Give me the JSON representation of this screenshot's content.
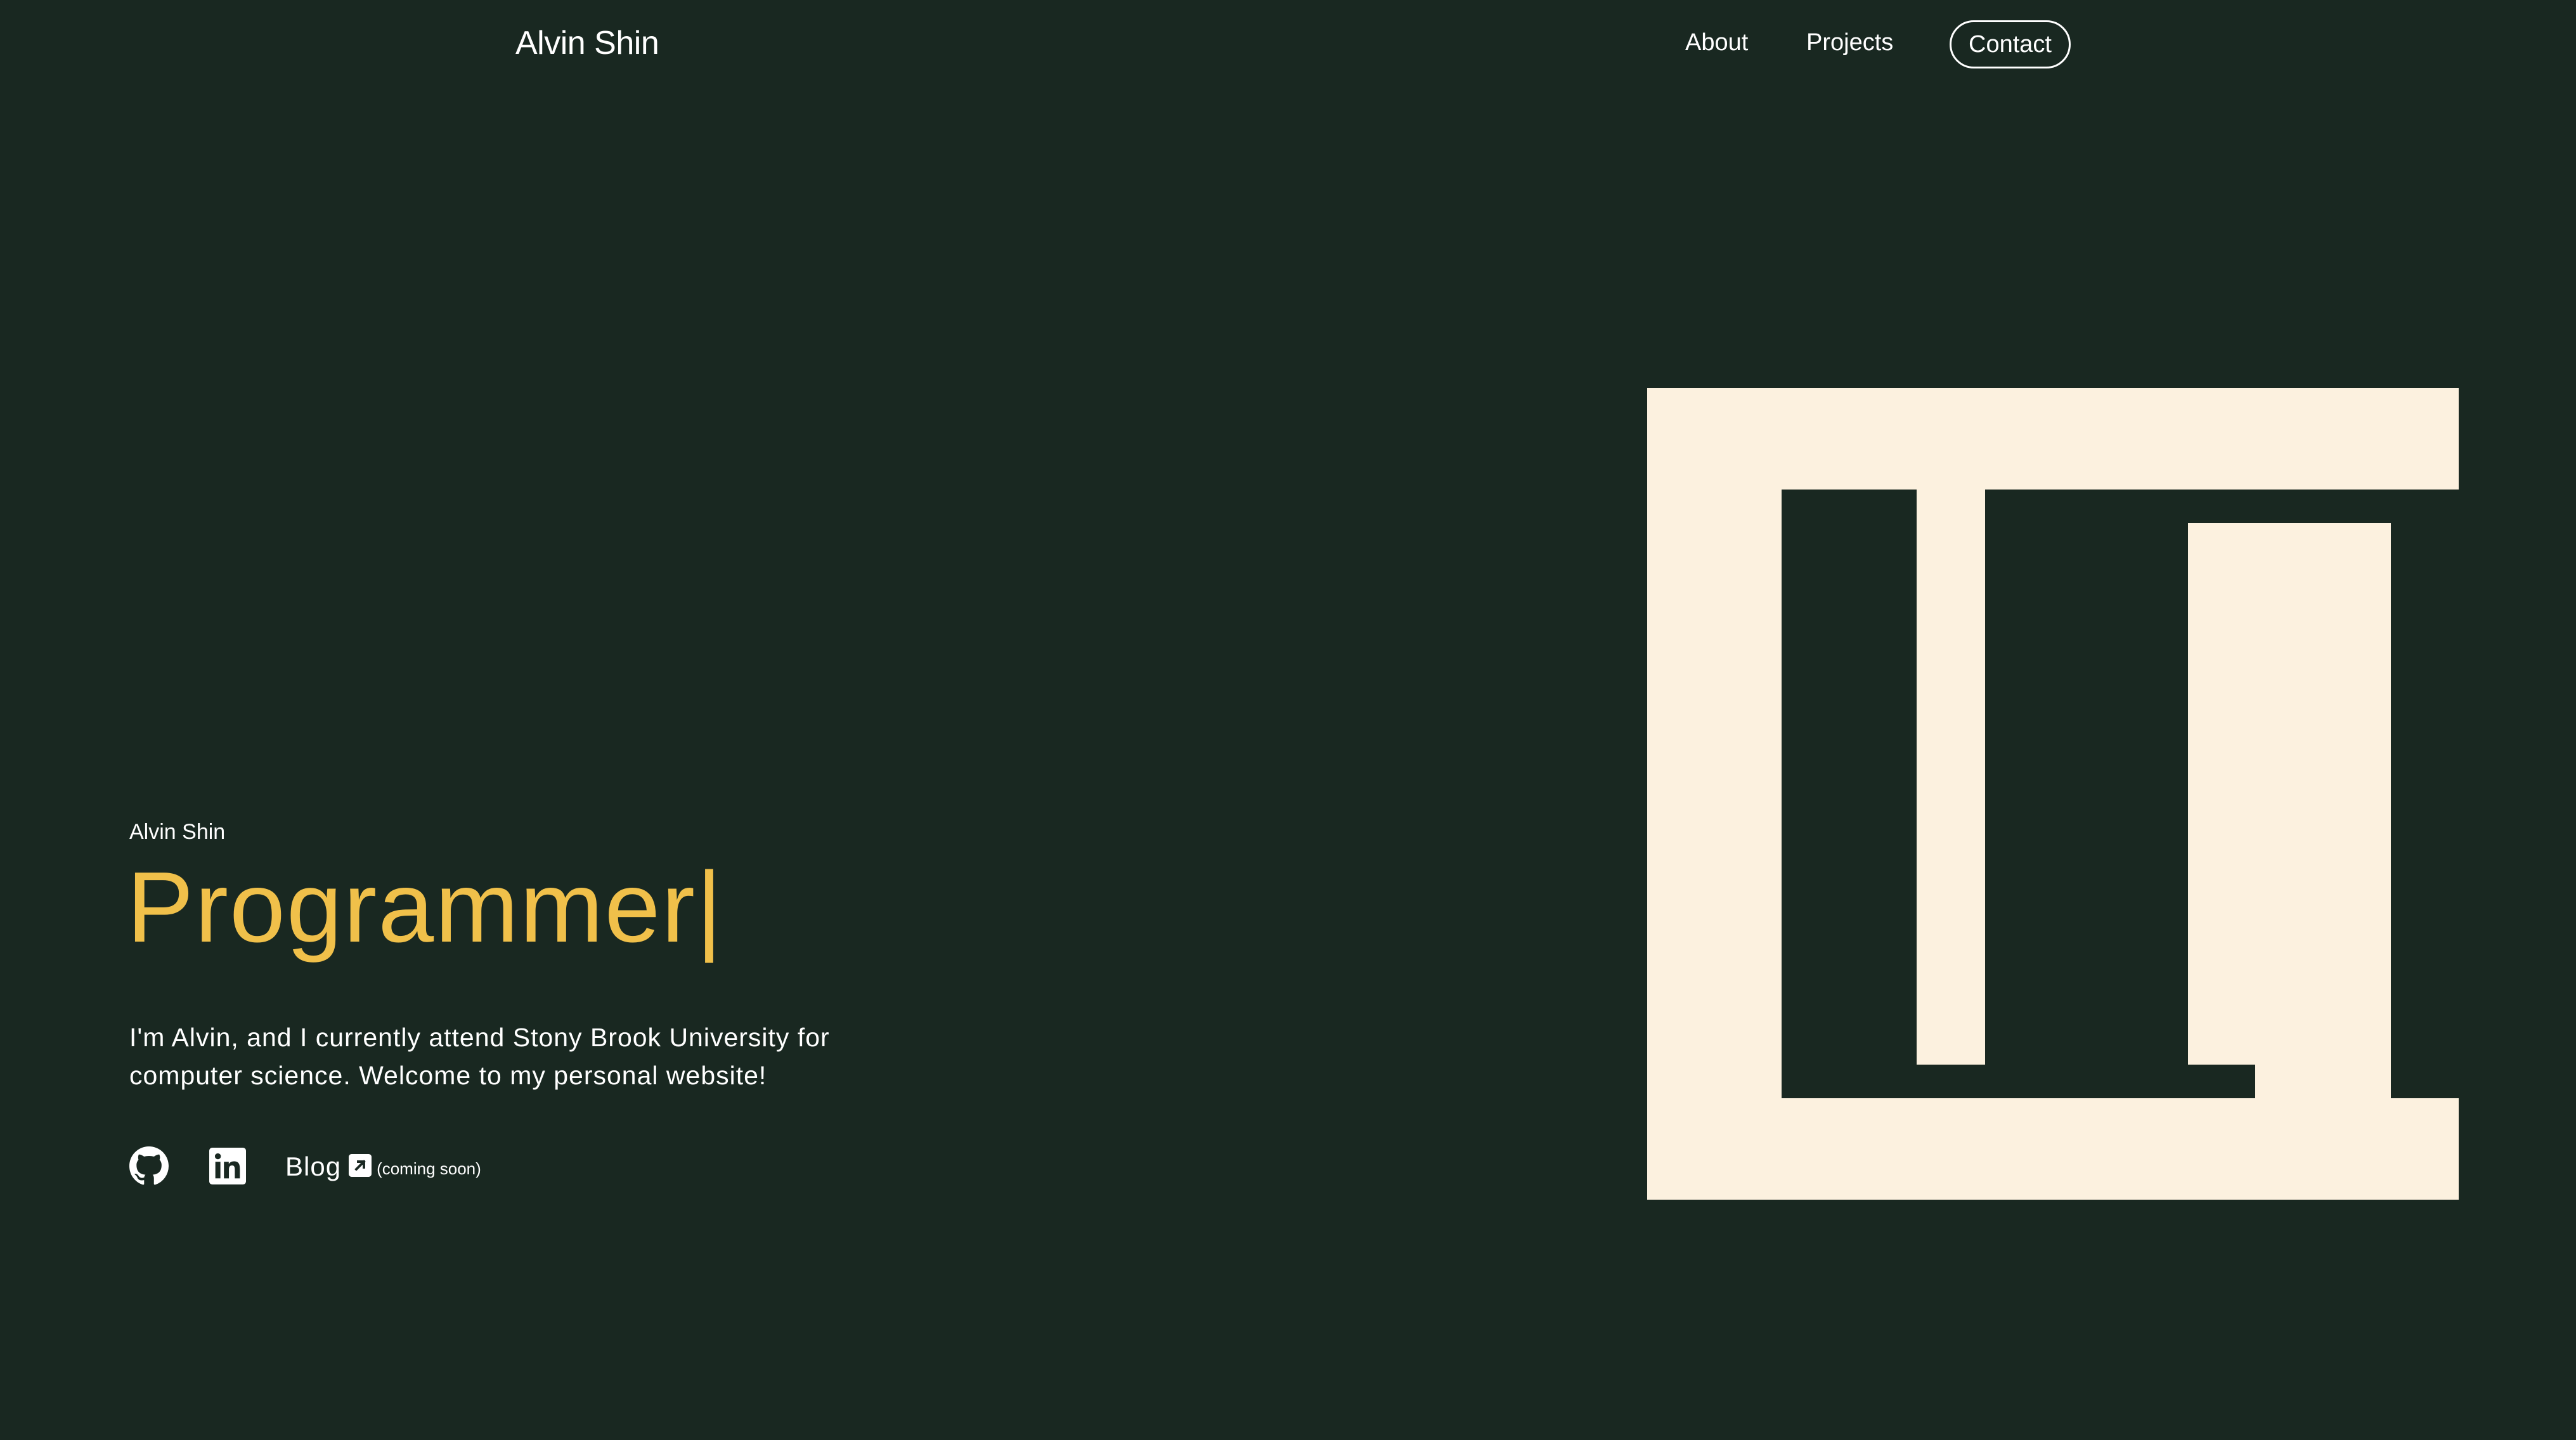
{
  "header": {
    "brand": "Alvin Shin",
    "nav": {
      "about": "About",
      "projects": "Projects",
      "contact": "Contact"
    }
  },
  "hero": {
    "eyebrow": "Alvin Shin",
    "title": "Programmer",
    "caret": "|",
    "description": "I'm Alvin, and I currently attend Stony Brook University for computer science. Welcome to my personal website!",
    "socials": {
      "github_icon": "github-icon",
      "linkedin_icon": "linkedin-icon",
      "blog_label": "Blog",
      "blog_icon": "external-link-icon",
      "blog_note": "(coming soon)"
    }
  },
  "colors": {
    "background": "#192821",
    "accent": "#f0c04a",
    "logo_background": "#fcf1df",
    "text": "#ffffff"
  }
}
